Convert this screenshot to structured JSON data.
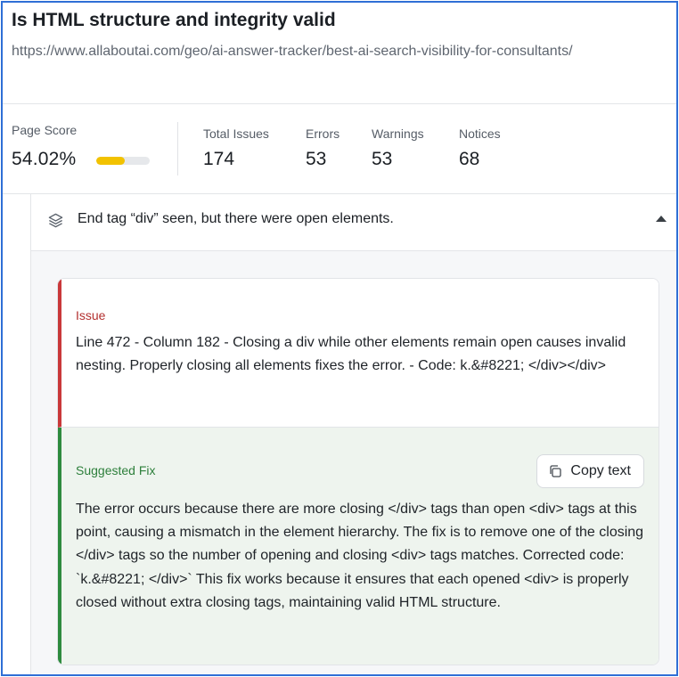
{
  "header": {
    "title": "Is HTML structure and integrity valid",
    "url": "https://www.allaboutai.com/geo/ai-answer-tracker/best-ai-search-visibility-for-consultants/"
  },
  "stats": {
    "page_score_label": "Page Score",
    "page_score_value": "54.02%",
    "page_score_fraction": 0.5402,
    "total_issues_label": "Total Issues",
    "total_issues_value": "174",
    "errors_label": "Errors",
    "errors_value": "53",
    "warnings_label": "Warnings",
    "warnings_value": "53",
    "notices_label": "Notices",
    "notices_value": "68"
  },
  "issue_row": {
    "icon": "layers-icon",
    "title": "End tag “div” seen, but there were open elements.",
    "expanded": true
  },
  "issue": {
    "label": "Issue",
    "text": "Line 472 - Column 182 - Closing a div while other elements remain open causes invalid nesting. Properly closing all elements fixes the error. - Code: k.&#8221; </div></div>"
  },
  "fix": {
    "label": "Suggested Fix",
    "copy_button": "Copy text",
    "copy_icon": "copy-icon",
    "text": "The error occurs because there are more closing </div> tags than open <div> tags at this point, causing a mismatch in the element hierarchy. The fix is to remove one of the closing </div> tags so the number of opening and closing <div> tags matches. Corrected code: `k.&#8221; </div>` This fix works because it ensures that each opened <div> is properly closed without extra closing tags, maintaining valid HTML structure."
  },
  "colors": {
    "frame_border": "#2f6fd6",
    "score_bar_fill": "#f2c200",
    "issue_accent": "#c9383a",
    "fix_accent": "#2e8b3f",
    "fix_background": "#eef4ee"
  }
}
